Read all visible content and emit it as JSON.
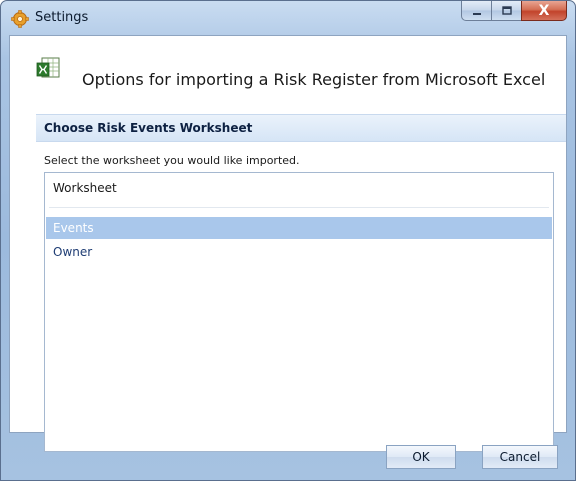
{
  "window": {
    "title": "Settings",
    "icon": "gear-icon",
    "caption_buttons": {
      "minimize": "minimize-icon",
      "maximize": "maximize-icon",
      "close": "X"
    }
  },
  "header": {
    "icon": "excel-icon",
    "title": "Options for importing a Risk Register from Microsoft Excel"
  },
  "section": {
    "title": "Choose Risk Events Worksheet",
    "instruction": "Select the worksheet you would like imported."
  },
  "worksheet_list": {
    "header": "Worksheet",
    "items": [
      {
        "label": "Events",
        "selected": true
      },
      {
        "label": "Owner",
        "selected": false
      }
    ]
  },
  "footer": {
    "ok_label": "OK",
    "cancel_label": "Cancel"
  },
  "colors": {
    "selection": "#a9c7eb",
    "list_text": "#1f3d74",
    "close_button": "#c2432b"
  }
}
